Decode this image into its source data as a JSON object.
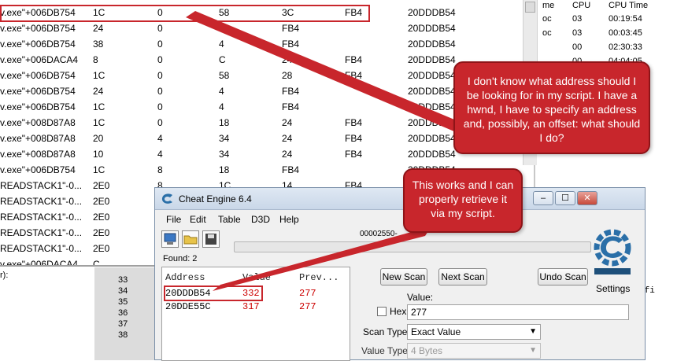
{
  "scan_table": {
    "rows": [
      [
        "v.exe\"+006DB754",
        "1C",
        "0",
        "58",
        "3C",
        "FB4",
        "20DDDB54"
      ],
      [
        "v.exe\"+006DB754",
        "24",
        "0",
        "18",
        "FB4",
        "",
        "20DDDB54"
      ],
      [
        "v.exe\"+006DB754",
        "38",
        "0",
        "4",
        "FB4",
        "",
        "20DDDB54"
      ],
      [
        "v.exe\"+006DACA4",
        "8",
        "0",
        "C",
        "24",
        "FB4",
        "20DDDB54"
      ],
      [
        "v.exe\"+006DB754",
        "1C",
        "0",
        "58",
        "28",
        "FB4",
        "20DDDB54"
      ],
      [
        "v.exe\"+006DB754",
        "24",
        "0",
        "4",
        "FB4",
        "",
        "20DDDB54"
      ],
      [
        "v.exe\"+006DB754",
        "1C",
        "0",
        "4",
        "FB4",
        "",
        "20DDDB54"
      ],
      [
        "v.exe\"+008D87A8",
        "1C",
        "0",
        "18",
        "24",
        "FB4",
        "20DDDB54"
      ],
      [
        "v.exe\"+008D87A8",
        "20",
        "4",
        "34",
        "24",
        "FB4",
        "20DDDB54"
      ],
      [
        "v.exe\"+008D87A8",
        "10",
        "4",
        "34",
        "24",
        "FB4",
        "20DDDB54"
      ],
      [
        "v.exe\"+006DB754",
        "1C",
        "8",
        "18",
        "FB4",
        "",
        "20DDDB54"
      ],
      [
        "READSTACK1\"-0...",
        "2E0",
        "8",
        "1C",
        "14",
        "FB4",
        ""
      ],
      [
        "READSTACK1\"-0...",
        "2E0",
        "",
        "",
        "",
        "",
        ""
      ],
      [
        "READSTACK1\"-0...",
        "2E0",
        "",
        "",
        "",
        "",
        ""
      ],
      [
        "READSTACK1\"-0...",
        "2E0",
        "",
        "",
        "",
        "",
        ""
      ],
      [
        "READSTACK1\"-0...",
        "2E0",
        "",
        "",
        "",
        "",
        ""
      ],
      [
        "v.exe\"+006DACA4",
        "C",
        "",
        "",
        "",
        "",
        ""
      ]
    ]
  },
  "process_list": {
    "headers": [
      "me",
      "CPU",
      "CPU Time"
    ],
    "rows": [
      [
        "oc",
        "03",
        "00:19:54"
      ],
      [
        "oc",
        "03",
        "00:03:45"
      ],
      [
        "",
        "00",
        "02:30:33"
      ],
      [
        "",
        "00",
        "04:04:05"
      ]
    ]
  },
  "editor": {
    "line_numbers": [
      "33",
      "34",
      "35",
      "36",
      "37",
      "38"
    ],
    "left_fragment": "r):",
    "code_fragment": "&fi"
  },
  "cheat_engine": {
    "title": "Cheat Engine 6.4",
    "window_buttons": [
      "–",
      "☐",
      "✕"
    ],
    "menu": [
      "File",
      "Edit",
      "Table",
      "D3D",
      "Help"
    ],
    "process_name": "00002550-",
    "found_label": "Found: 2",
    "results_headers": [
      "Address",
      "Value",
      "Prev..."
    ],
    "results": [
      {
        "address": "20DDDB54",
        "value": "332",
        "prev": "277"
      },
      {
        "address": "20DDE55C",
        "value": "317",
        "prev": "277"
      }
    ],
    "buttons": {
      "new_scan": "New Scan",
      "next_scan": "Next Scan",
      "undo_scan": "Undo Scan"
    },
    "value_label": "Value:",
    "hex_label": "Hex",
    "value_input": "277",
    "scan_type_label": "Scan Type",
    "scan_type_value": "Exact Value",
    "value_type_label": "Value Type",
    "value_type_value": "4 Bytes",
    "settings_label": "Settings",
    "logo_caption": "Cheat Engine"
  },
  "callouts": {
    "callout1": "I don't know what address should I be looking for in my script. I have a hwnd, I have to specify an address and, possibly, an offset: what should I do?",
    "callout2": "This works and I can properly retrieve it via my script."
  },
  "colors": {
    "callout_red": "#c8262c",
    "value_red": "#cc0000"
  }
}
